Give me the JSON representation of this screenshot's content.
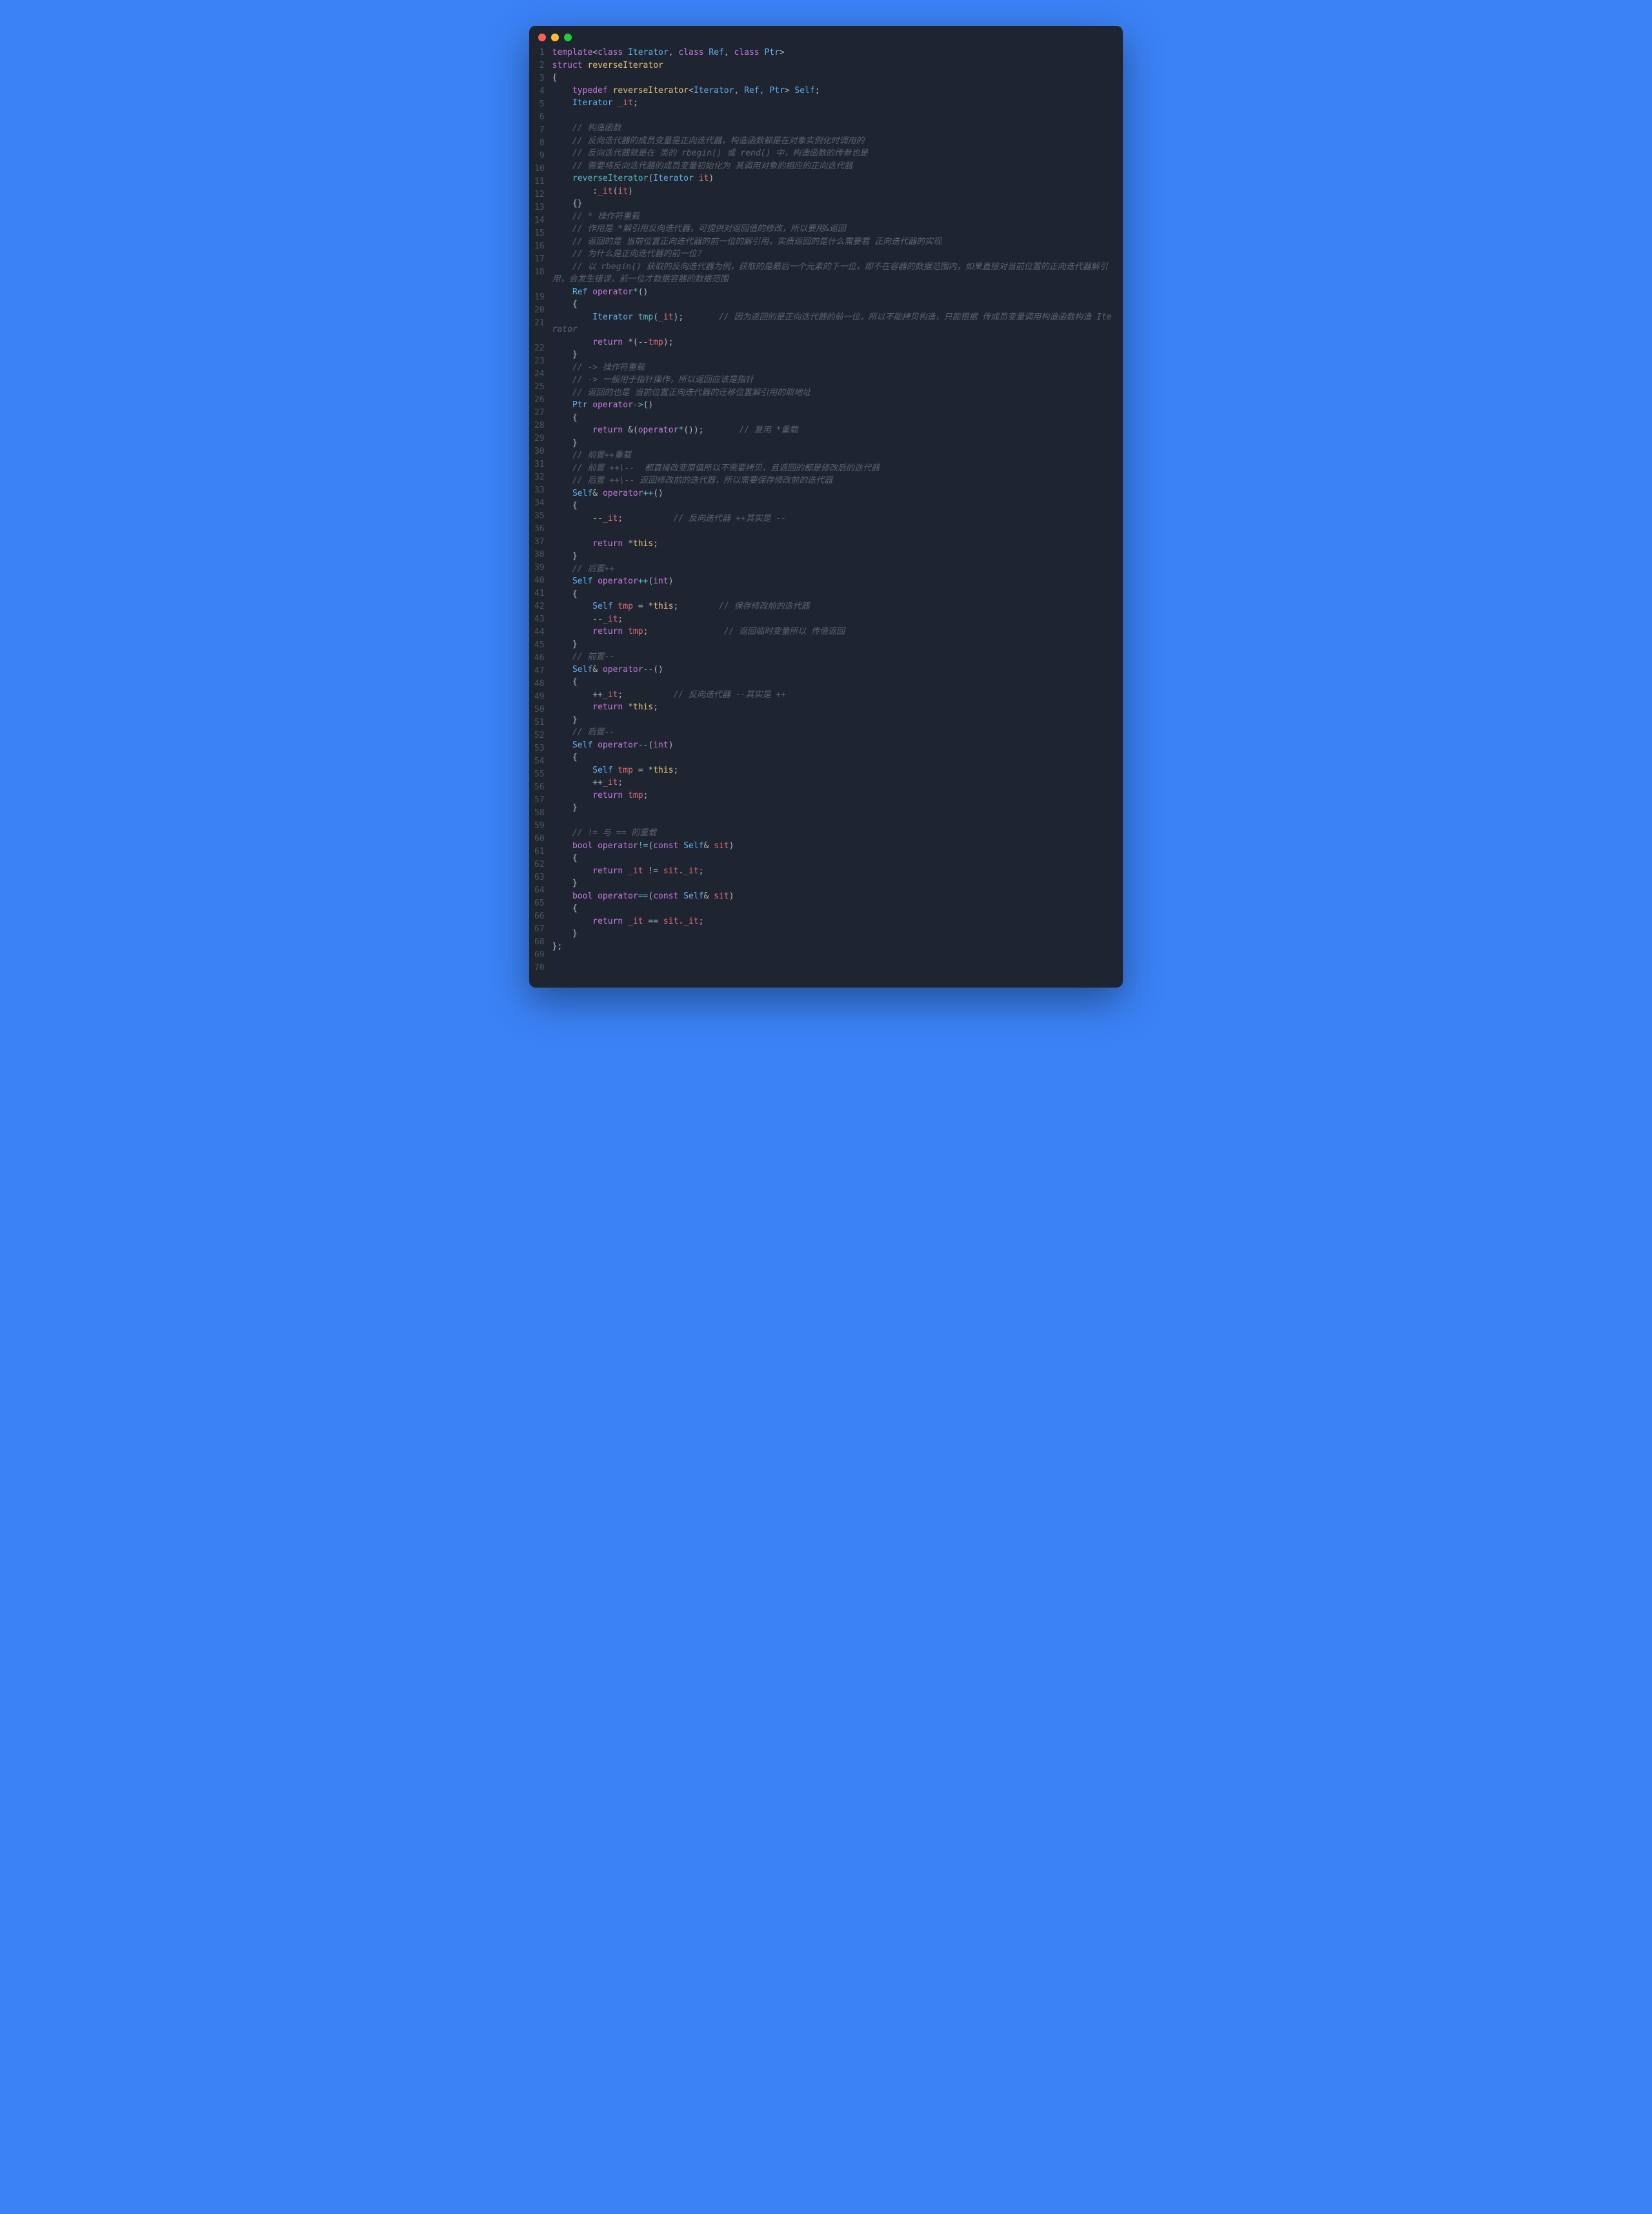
{
  "lines": [
    {
      "n": 1,
      "segs": [
        [
          "kw",
          "template"
        ],
        [
          "punct",
          "<"
        ],
        [
          "kw",
          "class"
        ],
        [
          "punct",
          " "
        ],
        [
          "type",
          "Iterator"
        ],
        [
          "punct",
          ", "
        ],
        [
          "kw",
          "class"
        ],
        [
          "punct",
          " "
        ],
        [
          "type",
          "Ref"
        ],
        [
          "punct",
          ", "
        ],
        [
          "kw",
          "class"
        ],
        [
          "punct",
          " "
        ],
        [
          "type",
          "Ptr"
        ],
        [
          "punct",
          ">"
        ]
      ]
    },
    {
      "n": 2,
      "segs": [
        [
          "kw",
          "struct"
        ],
        [
          "punct",
          " "
        ],
        [
          "ident",
          "reverseIterator"
        ]
      ]
    },
    {
      "n": 3,
      "segs": [
        [
          "punct",
          "{"
        ]
      ]
    },
    {
      "n": 4,
      "segs": [
        [
          "punct",
          "    "
        ],
        [
          "kw",
          "typedef"
        ],
        [
          "punct",
          " "
        ],
        [
          "ident",
          "reverseIterator"
        ],
        [
          "punct",
          "<"
        ],
        [
          "type",
          "Iterator"
        ],
        [
          "punct",
          ", "
        ],
        [
          "type",
          "Ref"
        ],
        [
          "punct",
          ", "
        ],
        [
          "type",
          "Ptr"
        ],
        [
          "punct",
          "> "
        ],
        [
          "type",
          "Self"
        ],
        [
          "punct",
          ";"
        ]
      ]
    },
    {
      "n": 5,
      "segs": [
        [
          "punct",
          "    "
        ],
        [
          "type",
          "Iterator"
        ],
        [
          "punct",
          " "
        ],
        [
          "param",
          "_it"
        ],
        [
          "punct",
          ";"
        ]
      ]
    },
    {
      "n": 6,
      "segs": []
    },
    {
      "n": 7,
      "segs": [
        [
          "punct",
          "    "
        ],
        [
          "comment",
          "// 构造函数"
        ]
      ]
    },
    {
      "n": 8,
      "segs": [
        [
          "punct",
          "    "
        ],
        [
          "comment",
          "// 反向迭代器的成员变量是正向迭代器，构造函数都是在对象实例化时调用的"
        ]
      ]
    },
    {
      "n": 9,
      "segs": [
        [
          "punct",
          "    "
        ],
        [
          "comment",
          "// 反向迭代器就是在 类的 rbegin() 或 rend() 中，构造函数的传参也是"
        ]
      ]
    },
    {
      "n": 10,
      "segs": [
        [
          "punct",
          "    "
        ],
        [
          "comment",
          "// 需要将反向迭代器的成员变量初始化为 其调用对象的相应的正向迭代器"
        ]
      ]
    },
    {
      "n": 11,
      "segs": [
        [
          "punct",
          "    "
        ],
        [
          "fn",
          "reverseIterator"
        ],
        [
          "punct",
          "("
        ],
        [
          "type",
          "Iterator"
        ],
        [
          "punct",
          " "
        ],
        [
          "param",
          "it"
        ],
        [
          "punct",
          ")"
        ]
      ]
    },
    {
      "n": 12,
      "segs": [
        [
          "punct",
          "        :"
        ],
        [
          "param",
          "_it"
        ],
        [
          "punct",
          "("
        ],
        [
          "param",
          "it"
        ],
        [
          "punct",
          ")"
        ]
      ]
    },
    {
      "n": 13,
      "segs": [
        [
          "punct",
          "    {}"
        ]
      ]
    },
    {
      "n": 14,
      "segs": [
        [
          "punct",
          "    "
        ],
        [
          "comment",
          "// * 操作符重载"
        ]
      ]
    },
    {
      "n": 15,
      "segs": [
        [
          "punct",
          "    "
        ],
        [
          "comment",
          "// 作用是 *解引用反向迭代器，可提供对返回值的修改，所以要用&返回"
        ]
      ]
    },
    {
      "n": 16,
      "segs": [
        [
          "punct",
          "    "
        ],
        [
          "comment",
          "// 返回的是 当前位置正向迭代器的前一位的解引用，实质返回的是什么需要看 正向迭代器的实现"
        ]
      ]
    },
    {
      "n": 17,
      "segs": [
        [
          "punct",
          "    "
        ],
        [
          "comment",
          "// 为什么是正向迭代器的前一位？"
        ]
      ]
    },
    {
      "n": 18,
      "segs": [
        [
          "punct",
          "    "
        ],
        [
          "comment",
          "// 以 rbegin() 获取的反向迭代器为例，获取的是最后一个元素的下一位，即不在容器的数据范围内，如果直接对当前位置的正向迭代器解引用，会发生错误，前一位才数据容器的数据范围"
        ]
      ]
    },
    {
      "n": 19,
      "segs": [
        [
          "punct",
          "    "
        ],
        [
          "type",
          "Ref"
        ],
        [
          "punct",
          " "
        ],
        [
          "kw",
          "operator"
        ],
        [
          "fn",
          "*"
        ],
        [
          "punct",
          "()"
        ]
      ]
    },
    {
      "n": 20,
      "segs": [
        [
          "punct",
          "    {"
        ]
      ]
    },
    {
      "n": 21,
      "segs": [
        [
          "punct",
          "        "
        ],
        [
          "type",
          "Iterator"
        ],
        [
          "punct",
          " "
        ],
        [
          "fn",
          "tmp"
        ],
        [
          "punct",
          "("
        ],
        [
          "param",
          "_it"
        ],
        [
          "punct",
          ");       "
        ],
        [
          "comment",
          "// 因为返回的是正向迭代器的前一位，所以不能拷贝构造，只能根据 传成员变量调用构造函数构造 Iterator"
        ]
      ]
    },
    {
      "n": 22,
      "segs": [
        [
          "punct",
          "        "
        ],
        [
          "kw",
          "return"
        ],
        [
          "punct",
          " *(--"
        ],
        [
          "param",
          "tmp"
        ],
        [
          "punct",
          ");"
        ]
      ]
    },
    {
      "n": 23,
      "segs": [
        [
          "punct",
          "    }"
        ]
      ]
    },
    {
      "n": 24,
      "segs": [
        [
          "punct",
          "    "
        ],
        [
          "comment",
          "// -> 操作符重载"
        ]
      ]
    },
    {
      "n": 25,
      "segs": [
        [
          "punct",
          "    "
        ],
        [
          "comment",
          "// -> 一般用于指针操作，所以返回应该是指针"
        ]
      ]
    },
    {
      "n": 26,
      "segs": [
        [
          "punct",
          "    "
        ],
        [
          "comment",
          "// 返回的也是 当前位置正向迭代器的迁移位置解引用的取地址"
        ]
      ]
    },
    {
      "n": 27,
      "segs": [
        [
          "punct",
          "    "
        ],
        [
          "type",
          "Ptr"
        ],
        [
          "punct",
          " "
        ],
        [
          "kw",
          "operator"
        ],
        [
          "fn",
          "->"
        ],
        [
          "punct",
          "()"
        ]
      ]
    },
    {
      "n": 28,
      "segs": [
        [
          "punct",
          "    {"
        ]
      ]
    },
    {
      "n": 29,
      "segs": [
        [
          "punct",
          "        "
        ],
        [
          "kw",
          "return"
        ],
        [
          "punct",
          " &("
        ],
        [
          "kw",
          "operator"
        ],
        [
          "fn",
          "*"
        ],
        [
          "punct",
          "());       "
        ],
        [
          "comment",
          "// 复用 *重载"
        ]
      ]
    },
    {
      "n": 30,
      "segs": [
        [
          "punct",
          "    }"
        ]
      ]
    },
    {
      "n": 31,
      "segs": [
        [
          "punct",
          "    "
        ],
        [
          "comment",
          "// 前置++重载"
        ]
      ]
    },
    {
      "n": 32,
      "segs": [
        [
          "punct",
          "    "
        ],
        [
          "comment",
          "// 前置 ++\\--  都直接改变原值所以不需要拷贝，且返回的都是修改后的迭代器"
        ]
      ]
    },
    {
      "n": 33,
      "segs": [
        [
          "punct",
          "    "
        ],
        [
          "comment",
          "// 后置 ++\\-- 返回修改前的迭代器，所以需要保存修改前的迭代器"
        ]
      ]
    },
    {
      "n": 34,
      "segs": [
        [
          "punct",
          "    "
        ],
        [
          "type",
          "Self"
        ],
        [
          "punct",
          "& "
        ],
        [
          "kw",
          "operator"
        ],
        [
          "fn",
          "++"
        ],
        [
          "punct",
          "()"
        ]
      ]
    },
    {
      "n": 35,
      "segs": [
        [
          "punct",
          "    {"
        ]
      ]
    },
    {
      "n": 36,
      "segs": [
        [
          "punct",
          "        --"
        ],
        [
          "param",
          "_it"
        ],
        [
          "punct",
          ";          "
        ],
        [
          "comment",
          "// 反向迭代器 ++其实是 --"
        ]
      ]
    },
    {
      "n": 37,
      "segs": []
    },
    {
      "n": 38,
      "segs": [
        [
          "punct",
          "        "
        ],
        [
          "kw",
          "return"
        ],
        [
          "punct",
          " *"
        ],
        [
          "this",
          "this"
        ],
        [
          "punct",
          ";"
        ]
      ]
    },
    {
      "n": 39,
      "segs": [
        [
          "punct",
          "    }"
        ]
      ]
    },
    {
      "n": 40,
      "segs": [
        [
          "punct",
          "    "
        ],
        [
          "comment",
          "// 后置++"
        ]
      ]
    },
    {
      "n": 41,
      "segs": [
        [
          "punct",
          "    "
        ],
        [
          "type",
          "Self"
        ],
        [
          "punct",
          " "
        ],
        [
          "kw",
          "operator"
        ],
        [
          "fn",
          "++"
        ],
        [
          "punct",
          "("
        ],
        [
          "kw",
          "int"
        ],
        [
          "punct",
          ")"
        ]
      ]
    },
    {
      "n": 42,
      "segs": [
        [
          "punct",
          "    {"
        ]
      ]
    },
    {
      "n": 43,
      "segs": [
        [
          "punct",
          "        "
        ],
        [
          "type",
          "Self"
        ],
        [
          "punct",
          " "
        ],
        [
          "param",
          "tmp"
        ],
        [
          "punct",
          " = *"
        ],
        [
          "this",
          "this"
        ],
        [
          "punct",
          ";        "
        ],
        [
          "comment",
          "// 保存修改前的迭代器"
        ]
      ]
    },
    {
      "n": 44,
      "segs": [
        [
          "punct",
          "        --"
        ],
        [
          "param",
          "_it"
        ],
        [
          "punct",
          ";"
        ]
      ]
    },
    {
      "n": 45,
      "segs": [
        [
          "punct",
          "        "
        ],
        [
          "kw",
          "return"
        ],
        [
          "punct",
          " "
        ],
        [
          "param",
          "tmp"
        ],
        [
          "punct",
          ";               "
        ],
        [
          "comment",
          "// 返回临时变量所以 传值返回"
        ]
      ]
    },
    {
      "n": 46,
      "segs": [
        [
          "punct",
          "    }"
        ]
      ]
    },
    {
      "n": 47,
      "segs": [
        [
          "punct",
          "    "
        ],
        [
          "comment",
          "// 前置--"
        ]
      ]
    },
    {
      "n": 48,
      "segs": [
        [
          "punct",
          "    "
        ],
        [
          "type",
          "Self"
        ],
        [
          "punct",
          "& "
        ],
        [
          "kw",
          "operator"
        ],
        [
          "fn",
          "--"
        ],
        [
          "punct",
          "()"
        ]
      ]
    },
    {
      "n": 49,
      "segs": [
        [
          "punct",
          "    {"
        ]
      ]
    },
    {
      "n": 50,
      "segs": [
        [
          "punct",
          "        ++"
        ],
        [
          "param",
          "_it"
        ],
        [
          "punct",
          ";          "
        ],
        [
          "comment",
          "// 反向迭代器 --其实是 ++"
        ]
      ]
    },
    {
      "n": 51,
      "segs": [
        [
          "punct",
          "        "
        ],
        [
          "kw",
          "return"
        ],
        [
          "punct",
          " *"
        ],
        [
          "this",
          "this"
        ],
        [
          "punct",
          ";"
        ]
      ]
    },
    {
      "n": 52,
      "segs": [
        [
          "punct",
          "    }"
        ]
      ]
    },
    {
      "n": 53,
      "segs": [
        [
          "punct",
          "    "
        ],
        [
          "comment",
          "// 后置--"
        ]
      ]
    },
    {
      "n": 54,
      "segs": [
        [
          "punct",
          "    "
        ],
        [
          "type",
          "Self"
        ],
        [
          "punct",
          " "
        ],
        [
          "kw",
          "operator"
        ],
        [
          "fn",
          "--"
        ],
        [
          "punct",
          "("
        ],
        [
          "kw",
          "int"
        ],
        [
          "punct",
          ")"
        ]
      ]
    },
    {
      "n": 55,
      "segs": [
        [
          "punct",
          "    {"
        ]
      ]
    },
    {
      "n": 56,
      "segs": [
        [
          "punct",
          "        "
        ],
        [
          "type",
          "Self"
        ],
        [
          "punct",
          " "
        ],
        [
          "param",
          "tmp"
        ],
        [
          "punct",
          " = *"
        ],
        [
          "this",
          "this"
        ],
        [
          "punct",
          ";"
        ]
      ]
    },
    {
      "n": 57,
      "segs": [
        [
          "punct",
          "        ++"
        ],
        [
          "param",
          "_it"
        ],
        [
          "punct",
          ";"
        ]
      ]
    },
    {
      "n": 58,
      "segs": [
        [
          "punct",
          "        "
        ],
        [
          "kw",
          "return"
        ],
        [
          "punct",
          " "
        ],
        [
          "param",
          "tmp"
        ],
        [
          "punct",
          ";"
        ]
      ]
    },
    {
      "n": 59,
      "segs": [
        [
          "punct",
          "    }"
        ]
      ]
    },
    {
      "n": 60,
      "segs": []
    },
    {
      "n": 61,
      "segs": [
        [
          "punct",
          "    "
        ],
        [
          "comment",
          "// != 与 == 的重载"
        ]
      ]
    },
    {
      "n": 62,
      "segs": [
        [
          "punct",
          "    "
        ],
        [
          "kw",
          "bool"
        ],
        [
          "punct",
          " "
        ],
        [
          "kw",
          "operator"
        ],
        [
          "fn",
          "!="
        ],
        [
          "punct",
          "("
        ],
        [
          "kw",
          "const"
        ],
        [
          "punct",
          " "
        ],
        [
          "type",
          "Self"
        ],
        [
          "punct",
          "& "
        ],
        [
          "param",
          "sit"
        ],
        [
          "punct",
          ")"
        ]
      ]
    },
    {
      "n": 63,
      "segs": [
        [
          "punct",
          "    {"
        ]
      ]
    },
    {
      "n": 64,
      "segs": [
        [
          "punct",
          "        "
        ],
        [
          "kw",
          "return"
        ],
        [
          "punct",
          " "
        ],
        [
          "param",
          "_it"
        ],
        [
          "punct",
          " != "
        ],
        [
          "param",
          "sit"
        ],
        [
          "punct",
          "."
        ],
        [
          "param",
          "_it"
        ],
        [
          "punct",
          ";"
        ]
      ]
    },
    {
      "n": 65,
      "segs": [
        [
          "punct",
          "    }"
        ]
      ]
    },
    {
      "n": 66,
      "segs": [
        [
          "punct",
          "    "
        ],
        [
          "kw",
          "bool"
        ],
        [
          "punct",
          " "
        ],
        [
          "kw",
          "operator"
        ],
        [
          "fn",
          "=="
        ],
        [
          "punct",
          "("
        ],
        [
          "kw",
          "const"
        ],
        [
          "punct",
          " "
        ],
        [
          "type",
          "Self"
        ],
        [
          "punct",
          "& "
        ],
        [
          "param",
          "sit"
        ],
        [
          "punct",
          ")"
        ]
      ]
    },
    {
      "n": 67,
      "segs": [
        [
          "punct",
          "    {"
        ]
      ]
    },
    {
      "n": 68,
      "segs": [
        [
          "punct",
          "        "
        ],
        [
          "kw",
          "return"
        ],
        [
          "punct",
          " "
        ],
        [
          "param",
          "_it"
        ],
        [
          "punct",
          " == "
        ],
        [
          "param",
          "sit"
        ],
        [
          "punct",
          "."
        ],
        [
          "param",
          "_it"
        ],
        [
          "punct",
          ";"
        ]
      ]
    },
    {
      "n": 69,
      "segs": [
        [
          "punct",
          "    }"
        ]
      ]
    },
    {
      "n": 70,
      "segs": [
        [
          "punct",
          "};"
        ]
      ]
    }
  ]
}
